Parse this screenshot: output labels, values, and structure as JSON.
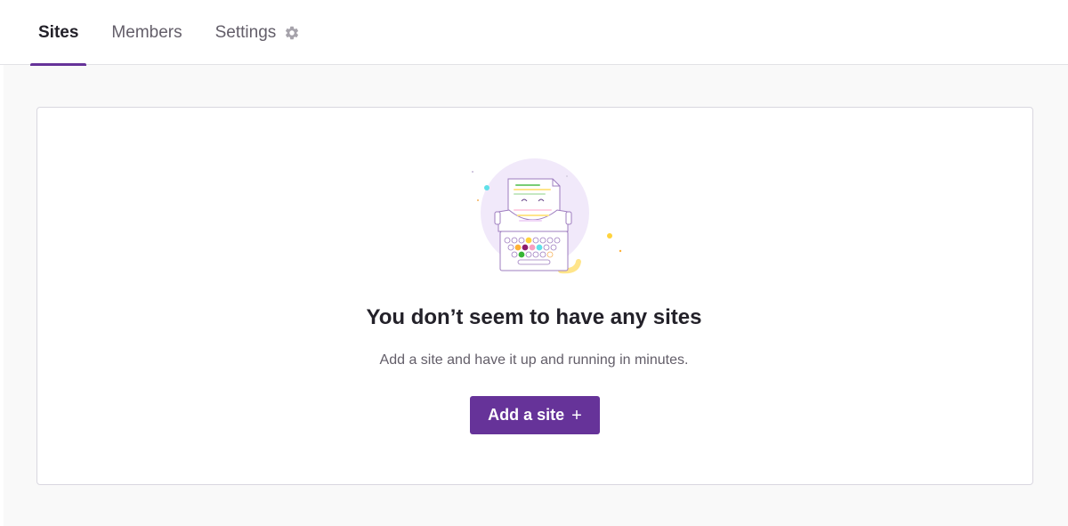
{
  "tabs": [
    {
      "label": "Sites",
      "active": true
    },
    {
      "label": "Members",
      "active": false
    },
    {
      "label": "Settings",
      "active": false,
      "icon": "gear-icon"
    }
  ],
  "empty_state": {
    "title": "You don’t seem to have any sites",
    "description": "Add a site and have it up and running in minutes.",
    "button_label": "Add a site",
    "button_icon": "+",
    "illustration": "typewriter-illustration"
  },
  "colors": {
    "accent": "#663399",
    "text": "#232129",
    "muted_text": "#635e69",
    "page_background": "#f9f9f9",
    "card_border": "#d9d7e0"
  }
}
